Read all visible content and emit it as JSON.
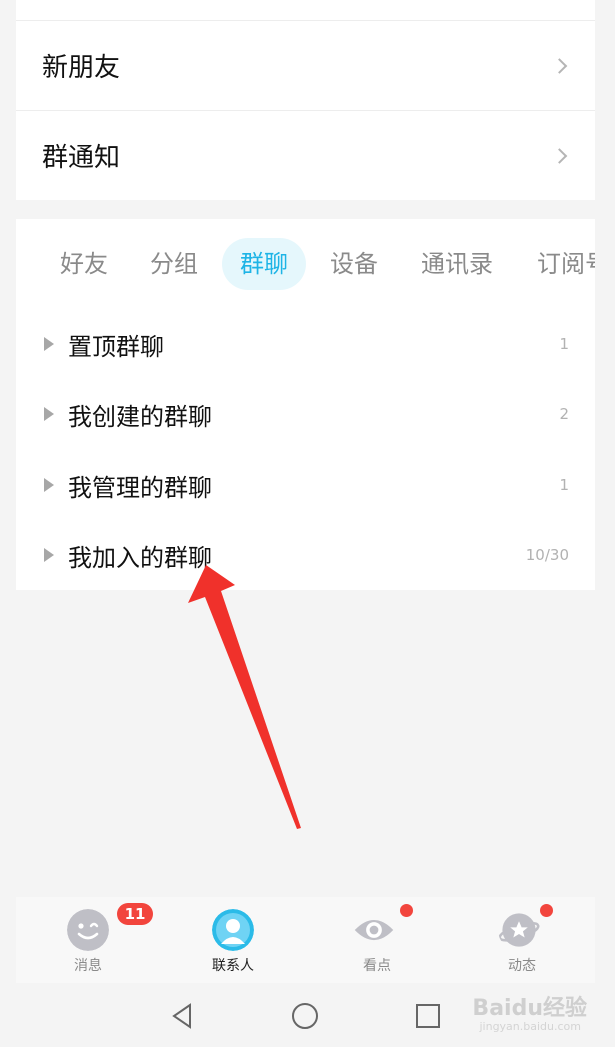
{
  "top_card": {
    "items": [
      {
        "label": "新朋友"
      },
      {
        "label": "群通知"
      }
    ]
  },
  "tabs": [
    {
      "label": "好友",
      "active": false
    },
    {
      "label": "分组",
      "active": false
    },
    {
      "label": "群聊",
      "active": true
    },
    {
      "label": "设备",
      "active": false
    },
    {
      "label": "通讯录",
      "active": false
    },
    {
      "label": "订阅号",
      "active": false
    }
  ],
  "groups": [
    {
      "name": "置顶群聊",
      "count": "1"
    },
    {
      "name": "我创建的群聊",
      "count": "2"
    },
    {
      "name": "我管理的群聊",
      "count": "1"
    },
    {
      "name": "我加入的群聊",
      "count": "10/30"
    }
  ],
  "bottom_nav": [
    {
      "label": "消息",
      "badge": "11",
      "icon": "message-face-icon"
    },
    {
      "label": "联系人",
      "icon": "contact-person-icon",
      "active": true
    },
    {
      "label": "看点",
      "icon": "eye-icon",
      "dot": true
    },
    {
      "label": "动态",
      "icon": "star-planet-icon",
      "dot": true
    }
  ],
  "watermark": {
    "logo": "Baidu经验",
    "url": "jingyan.baidu.com"
  },
  "colors": {
    "accent": "#1eb4e6",
    "accent_bg": "#e5f7fc",
    "badge": "#f2453d",
    "annotation_arrow": "#f0312b"
  }
}
